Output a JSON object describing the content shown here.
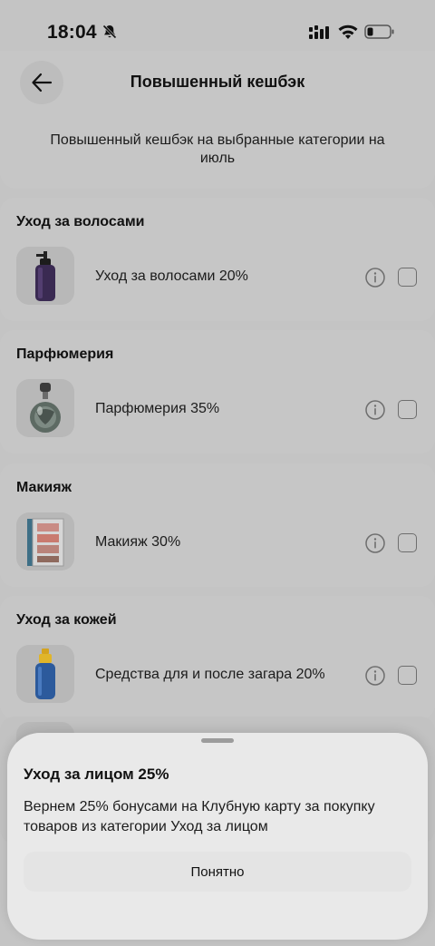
{
  "status_bar": {
    "time": "18:04"
  },
  "header": {
    "title": "Повышенный кешбэк",
    "subtitle": "Повышенный кешбэк на выбранные категории на июль"
  },
  "categories": [
    {
      "title": "Уход за волосами",
      "item_label": "Уход за волосами 20%",
      "icon": "shampoo-bottle-icon"
    },
    {
      "title": "Парфюмерия",
      "item_label": "Парфюмерия 35%",
      "icon": "perfume-bottle-icon"
    },
    {
      "title": "Макияж",
      "item_label": "Макияж 30%",
      "icon": "eyeshadow-palette-icon"
    },
    {
      "title": "Уход за кожей",
      "item_label": "Средства для и после загара 20%",
      "icon": "sunscreen-bottle-icon"
    }
  ],
  "sheet": {
    "title": "Уход за лицом 25%",
    "text": "Вернем 25% бонусами на Клубную карту за покупку товаров из категории Уход за лицом",
    "button_label": "Понятно"
  },
  "colors": {
    "background": "#c4c4c4",
    "sheet": "#e9e9e9",
    "text": "#1c1c1c"
  }
}
